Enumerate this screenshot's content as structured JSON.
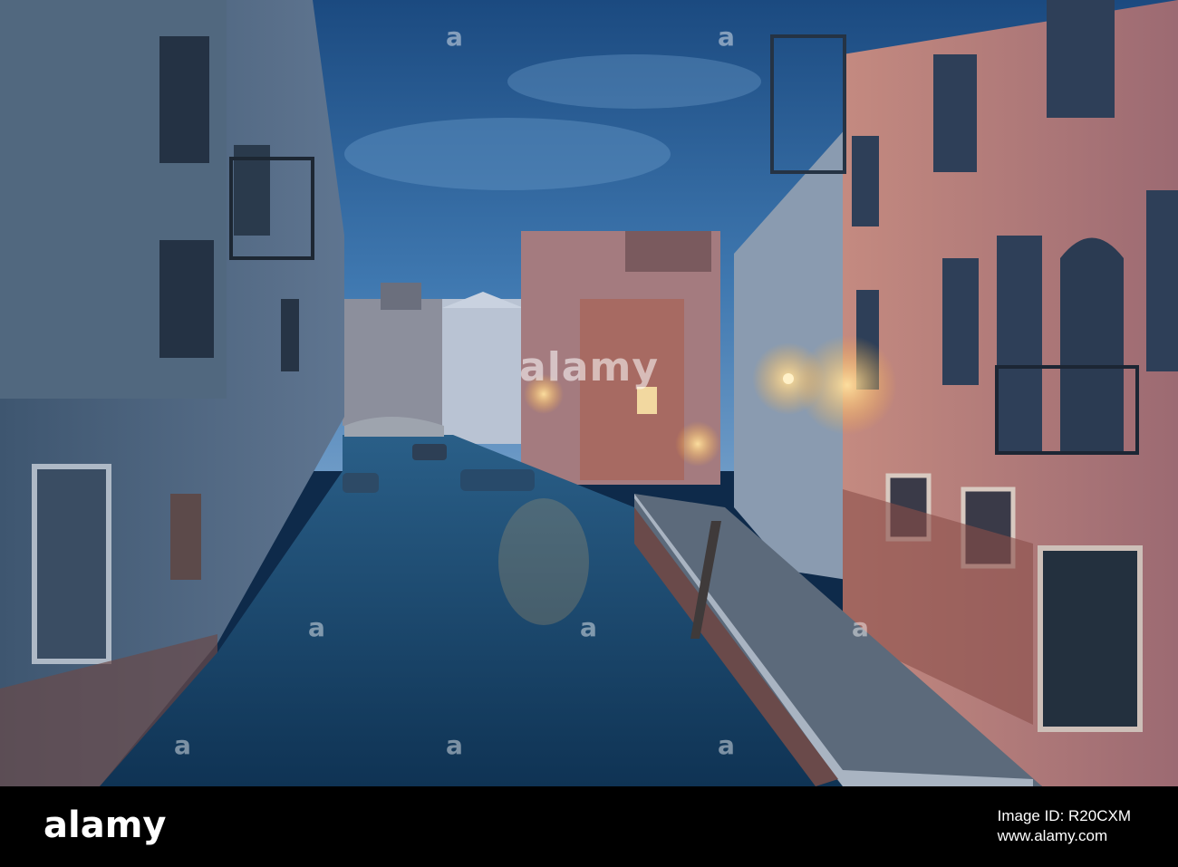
{
  "photo": {
    "subject": "Venice canal at dusk",
    "colors": {
      "sky_top": "#1d4f86",
      "sky_bottom": "#4d86bd",
      "water": "#153f62",
      "left_wall": "#52677f",
      "right_wall_pink": "#b27b78",
      "right_wall_light": "#8899aa",
      "lamp_glow": "#ffcf7a"
    }
  },
  "watermark": {
    "main": "alamy",
    "small": "a"
  },
  "footer": {
    "logo": "alamy",
    "image_id_label": "Image ID: R20CXM",
    "site": "www.alamy.com"
  }
}
